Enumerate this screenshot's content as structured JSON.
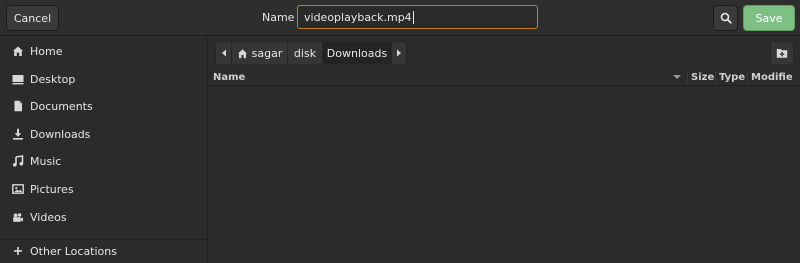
{
  "header": {
    "cancel_label": "Cancel",
    "name_label": "Name",
    "name_value": "videoplayback.mp4",
    "save_label": "Save"
  },
  "sidebar": {
    "items": [
      {
        "label": "Home",
        "icon": "home-icon"
      },
      {
        "label": "Desktop",
        "icon": "desktop-icon"
      },
      {
        "label": "Documents",
        "icon": "document-icon"
      },
      {
        "label": "Downloads",
        "icon": "download-icon"
      },
      {
        "label": "Music",
        "icon": "music-icon"
      },
      {
        "label": "Pictures",
        "icon": "pictures-icon"
      },
      {
        "label": "Videos",
        "icon": "videos-icon"
      },
      {
        "label": "Other Locations",
        "icon": "plus-icon"
      }
    ]
  },
  "path": {
    "crumbs": [
      "sagar",
      "disk",
      "Downloads"
    ]
  },
  "list": {
    "columns": [
      "Name",
      "Size",
      "Type",
      "Modifie"
    ]
  },
  "colors": {
    "accent_focus": "#c47c1a",
    "save_green": "#7ebf84",
    "background": "#2b2b2b"
  }
}
